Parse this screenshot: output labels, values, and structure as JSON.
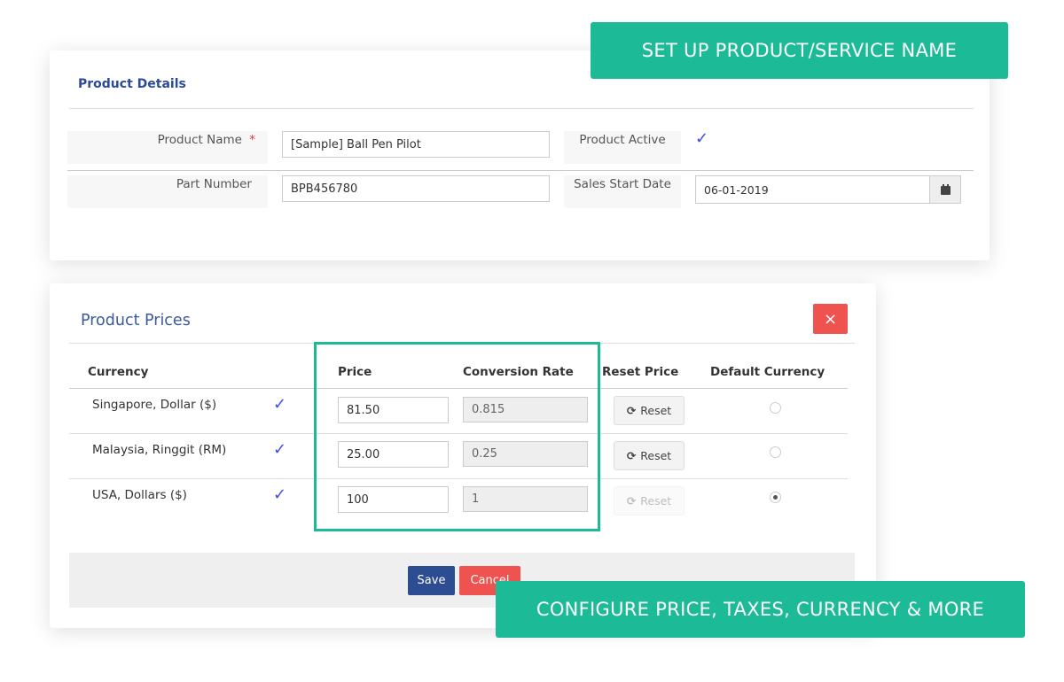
{
  "callouts": {
    "top": "SET UP PRODUCT/SERVICE NAME",
    "bottom": "CONFIGURE PRICE, TAXES, CURRENCY & MORE"
  },
  "colors": {
    "accent": "#1dba98",
    "primary": "#2d4d93",
    "danger": "#ef5350",
    "check": "#3b4ef0"
  },
  "details": {
    "title": "Product Details",
    "product_name_label": "Product Name",
    "required_mark": "*",
    "product_name": "[Sample] Ball Pen Pilot",
    "product_active_label": "Product Active",
    "product_active": true,
    "check": "✓",
    "part_number_label": "Part Number",
    "part_number": "BPB456780",
    "sales_start_label": "Sales Start Date",
    "sales_start": "06-01-2019",
    "calendar_icon": "calendar-icon"
  },
  "prices": {
    "title": "Product Prices",
    "close": "×",
    "headers": [
      "Currency",
      "Price",
      "Conversion Rate",
      "Reset Price",
      "Default Currency"
    ],
    "rows": [
      {
        "currency": "Singapore, Dollar ($)",
        "active": "✓",
        "price": "81.50",
        "rate": "0.815",
        "reset": "Reset",
        "reset_enabled": true,
        "default": false
      },
      {
        "currency": "Malaysia, Ringgit (RM)",
        "active": "✓",
        "price": "25.00",
        "rate": "0.25",
        "reset": "Reset",
        "reset_enabled": true,
        "default": false
      },
      {
        "currency": "USA, Dollars ($)",
        "active": "✓",
        "price": "100",
        "rate": "1",
        "reset": "Reset",
        "reset_enabled": false,
        "default": true
      }
    ],
    "save": "Save",
    "cancel": "Cancel"
  }
}
